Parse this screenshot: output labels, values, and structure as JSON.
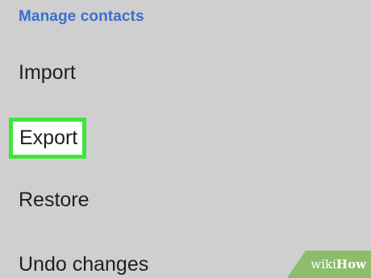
{
  "section": {
    "title": "Manage contacts"
  },
  "menu": {
    "items": [
      {
        "label": "Import"
      },
      {
        "label": "Export",
        "highlighted": true
      },
      {
        "label": "Restore"
      },
      {
        "label": "Undo changes"
      }
    ]
  },
  "watermark": {
    "wiki": "wiki",
    "how": "How"
  },
  "colors": {
    "background": "#cfcfcf",
    "header_text": "#3a6fd0",
    "highlight_border": "#3fe63a",
    "watermark_bg": "#8bbd6b"
  }
}
